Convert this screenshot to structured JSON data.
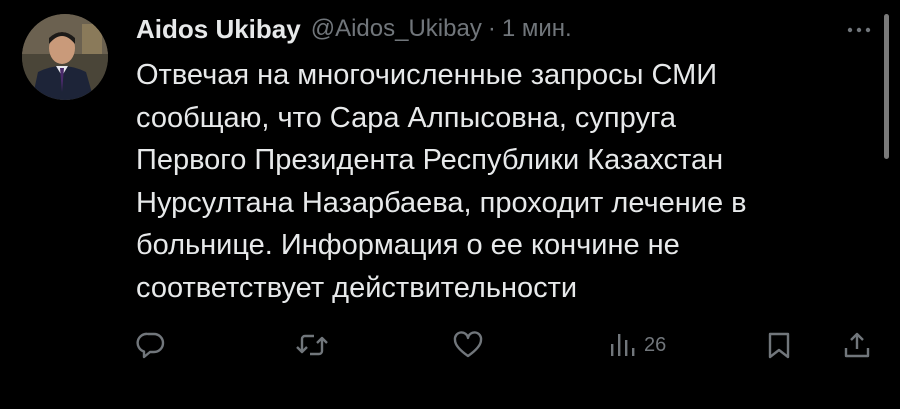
{
  "tweet": {
    "author_name": "Aidos Ukibay",
    "handle": "@Aidos_Ukibay",
    "separator": "·",
    "time": "1 мин.",
    "lines": [
      "Отвечая на многочисленные запросы СМИ",
      "сообщаю, что Сара Алпысовна, супруга",
      "Первого Президента Республики Казахстан",
      "Нурсултана Назарбаева, проходит лечение в",
      "больнице. Информация о ее кончине не",
      "соответствует действительности"
    ]
  },
  "actions": {
    "reply_icon": "reply-icon",
    "retweet_icon": "retweet-icon",
    "like_icon": "heart-icon",
    "views_icon": "views-chart-icon",
    "views_count": "26",
    "bookmark_icon": "bookmark-icon",
    "share_icon": "share-icon"
  },
  "colors": {
    "background": "#000000",
    "text": "#e7e9ea",
    "muted": "#71767b"
  }
}
